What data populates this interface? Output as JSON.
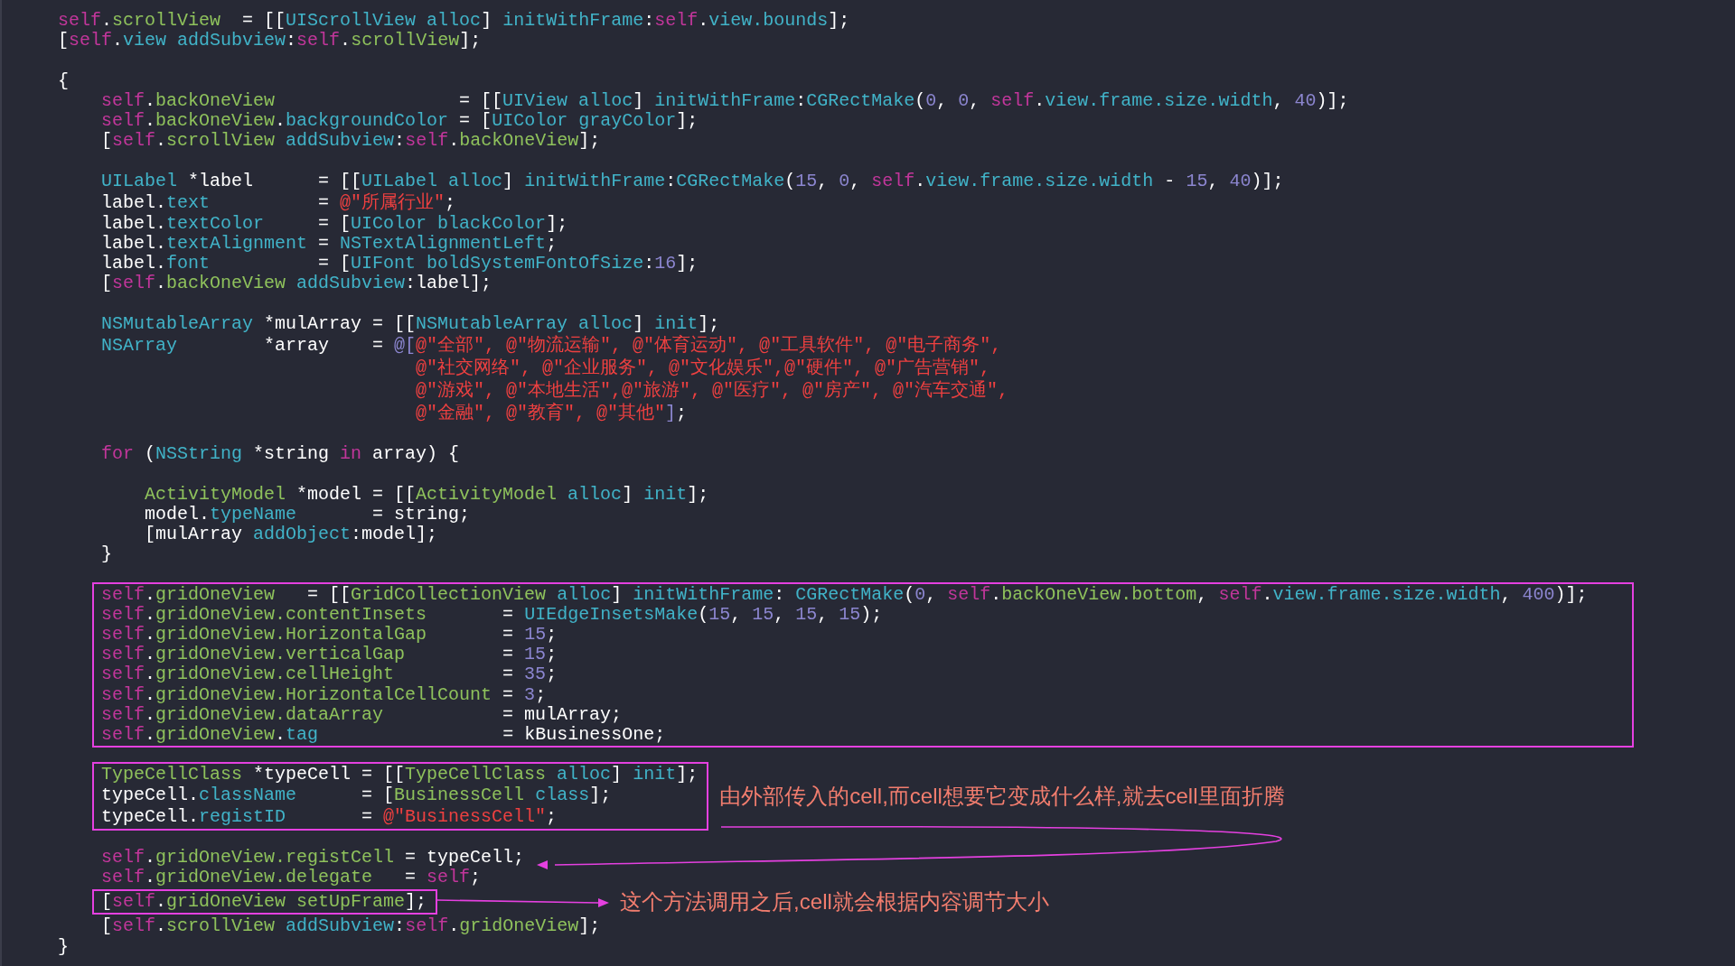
{
  "editor": {
    "sections": [
      {
        "blocks": [
          {
            "boxed": false,
            "lines": [
              [
                {
                  "kind": "kw",
                  "text": "self"
                },
                {
                  "kind": "plain",
                  "text": "."
                },
                {
                  "kind": "proj",
                  "text": "scrollView"
                },
                {
                  "kind": "plain",
                  "text": "  = [["
                },
                {
                  "kind": "sys",
                  "text": "UIScrollView alloc"
                },
                {
                  "kind": "plain",
                  "text": "] "
                },
                {
                  "kind": "sys",
                  "text": "initWithFrame"
                },
                {
                  "kind": "plain",
                  "text": ":"
                },
                {
                  "kind": "kw",
                  "text": "self"
                },
                {
                  "kind": "plain",
                  "text": "."
                },
                {
                  "kind": "sys",
                  "text": "view.bounds"
                },
                {
                  "kind": "plain",
                  "text": "];"
                }
              ],
              [
                {
                  "kind": "plain",
                  "text": "["
                },
                {
                  "kind": "kw",
                  "text": "self"
                },
                {
                  "kind": "plain",
                  "text": "."
                },
                {
                  "kind": "sys",
                  "text": "view addSubview"
                },
                {
                  "kind": "plain",
                  "text": ":"
                },
                {
                  "kind": "kw",
                  "text": "self"
                },
                {
                  "kind": "plain",
                  "text": "."
                },
                {
                  "kind": "proj",
                  "text": "scrollView"
                },
                {
                  "kind": "plain",
                  "text": "];"
                }
              ]
            ]
          }
        ]
      },
      {
        "blocks": [
          {
            "boxed": false,
            "lines": [
              [
                {
                  "kind": "plain",
                  "text": "{"
                }
              ]
            ]
          },
          {
            "boxed": false,
            "lines": [
              [
                {
                  "kind": "kw",
                  "text": "    self"
                },
                {
                  "kind": "plain",
                  "text": "."
                },
                {
                  "kind": "proj",
                  "text": "backOneView"
                },
                {
                  "kind": "plain",
                  "text": "                 = [["
                },
                {
                  "kind": "sys",
                  "text": "UIView alloc"
                },
                {
                  "kind": "plain",
                  "text": "] "
                },
                {
                  "kind": "sys",
                  "text": "initWithFrame"
                },
                {
                  "kind": "plain",
                  "text": ":"
                },
                {
                  "kind": "sys",
                  "text": "CGRectMake"
                },
                {
                  "kind": "plain",
                  "text": "("
                },
                {
                  "kind": "num",
                  "text": "0"
                },
                {
                  "kind": "plain",
                  "text": ", "
                },
                {
                  "kind": "num",
                  "text": "0"
                },
                {
                  "kind": "plain",
                  "text": ", "
                },
                {
                  "kind": "kw",
                  "text": "self"
                },
                {
                  "kind": "plain",
                  "text": "."
                },
                {
                  "kind": "sys",
                  "text": "view.frame.size.width"
                },
                {
                  "kind": "plain",
                  "text": ", "
                },
                {
                  "kind": "num",
                  "text": "40"
                },
                {
                  "kind": "plain",
                  "text": ")];"
                }
              ],
              [
                {
                  "kind": "kw",
                  "text": "    self"
                },
                {
                  "kind": "plain",
                  "text": "."
                },
                {
                  "kind": "proj",
                  "text": "backOneView"
                },
                {
                  "kind": "plain",
                  "text": "."
                },
                {
                  "kind": "sys",
                  "text": "backgroundColor"
                },
                {
                  "kind": "plain",
                  "text": " = ["
                },
                {
                  "kind": "sys",
                  "text": "UIColor grayColor"
                },
                {
                  "kind": "plain",
                  "text": "];"
                }
              ],
              [
                {
                  "kind": "plain",
                  "text": "    ["
                },
                {
                  "kind": "kw",
                  "text": "self"
                },
                {
                  "kind": "plain",
                  "text": "."
                },
                {
                  "kind": "proj",
                  "text": "scrollView"
                },
                {
                  "kind": "sys",
                  "text": " addSubview"
                },
                {
                  "kind": "plain",
                  "text": ":"
                },
                {
                  "kind": "kw",
                  "text": "self"
                },
                {
                  "kind": "plain",
                  "text": "."
                },
                {
                  "kind": "proj",
                  "text": "backOneView"
                },
                {
                  "kind": "plain",
                  "text": "];"
                }
              ]
            ]
          }
        ]
      },
      {
        "blocks": [
          {
            "boxed": false,
            "lines": [
              [
                {
                  "kind": "sys",
                  "text": "    UILabel"
                },
                {
                  "kind": "plain",
                  "text": " *label      = [["
                },
                {
                  "kind": "sys",
                  "text": "UILabel alloc"
                },
                {
                  "kind": "plain",
                  "text": "] "
                },
                {
                  "kind": "sys",
                  "text": "initWithFrame"
                },
                {
                  "kind": "plain",
                  "text": ":"
                },
                {
                  "kind": "sys",
                  "text": "CGRectMake"
                },
                {
                  "kind": "plain",
                  "text": "("
                },
                {
                  "kind": "num",
                  "text": "15"
                },
                {
                  "kind": "plain",
                  "text": ", "
                },
                {
                  "kind": "num",
                  "text": "0"
                },
                {
                  "kind": "plain",
                  "text": ", "
                },
                {
                  "kind": "kw",
                  "text": "self"
                },
                {
                  "kind": "plain",
                  "text": "."
                },
                {
                  "kind": "sys",
                  "text": "view.frame.size.width"
                },
                {
                  "kind": "plain",
                  "text": " - "
                },
                {
                  "kind": "num",
                  "text": "15"
                },
                {
                  "kind": "plain",
                  "text": ", "
                },
                {
                  "kind": "num",
                  "text": "40"
                },
                {
                  "kind": "plain",
                  "text": ")];"
                }
              ],
              [
                {
                  "kind": "plain",
                  "text": "    label."
                },
                {
                  "kind": "sys",
                  "text": "text"
                },
                {
                  "kind": "plain",
                  "text": "          = "
                },
                {
                  "kind": "str",
                  "text": "@\"所属行业\""
                },
                {
                  "kind": "plain",
                  "text": ";"
                }
              ],
              [
                {
                  "kind": "plain",
                  "text": "    label."
                },
                {
                  "kind": "sys",
                  "text": "textColor"
                },
                {
                  "kind": "plain",
                  "text": "     = ["
                },
                {
                  "kind": "sys",
                  "text": "UIColor blackColor"
                },
                {
                  "kind": "plain",
                  "text": "];"
                }
              ],
              [
                {
                  "kind": "plain",
                  "text": "    label."
                },
                {
                  "kind": "sys",
                  "text": "textAlignment"
                },
                {
                  "kind": "plain",
                  "text": " = "
                },
                {
                  "kind": "sys",
                  "text": "NSTextAlignmentLeft"
                },
                {
                  "kind": "plain",
                  "text": ";"
                }
              ],
              [
                {
                  "kind": "plain",
                  "text": "    label."
                },
                {
                  "kind": "sys",
                  "text": "font"
                },
                {
                  "kind": "plain",
                  "text": "          = ["
                },
                {
                  "kind": "sys",
                  "text": "UIFont boldSystemFontOfSize"
                },
                {
                  "kind": "plain",
                  "text": ":"
                },
                {
                  "kind": "num",
                  "text": "16"
                },
                {
                  "kind": "plain",
                  "text": "];"
                }
              ],
              [
                {
                  "kind": "plain",
                  "text": "    ["
                },
                {
                  "kind": "kw",
                  "text": "self"
                },
                {
                  "kind": "plain",
                  "text": "."
                },
                {
                  "kind": "proj",
                  "text": "backOneView"
                },
                {
                  "kind": "sys",
                  "text": " addSubview"
                },
                {
                  "kind": "plain",
                  "text": ":label];"
                }
              ]
            ]
          }
        ]
      },
      {
        "blocks": [
          {
            "boxed": false,
            "lines": [
              [
                {
                  "kind": "sys",
                  "text": "    NSMutableArray"
                },
                {
                  "kind": "plain",
                  "text": " *mulArray = [["
                },
                {
                  "kind": "sys",
                  "text": "NSMutableArray alloc"
                },
                {
                  "kind": "plain",
                  "text": "] "
                },
                {
                  "kind": "sys",
                  "text": "init"
                },
                {
                  "kind": "plain",
                  "text": "];"
                }
              ],
              [
                {
                  "kind": "sys",
                  "text": "    NSArray"
                },
                {
                  "kind": "plain",
                  "text": "        *array    = "
                },
                {
                  "kind": "num",
                  "text": "@["
                },
                {
                  "kind": "str",
                  "text": "@\"全部\", @\"物流运输\", @\"体育运动\", @\"工具软件\", @\"电子商务\","
                }
              ],
              [
                {
                  "kind": "str",
                  "text": "                                 @\"社交网络\", @\"企业服务\", @\"文化娱乐\",@\"硬件\", @\"广告营销\","
                }
              ],
              [
                {
                  "kind": "str",
                  "text": "                                 @\"游戏\", @\"本地生活\",@\"旅游\", @\"医疗\", @\"房产\", @\"汽车交通\","
                }
              ],
              [
                {
                  "kind": "str",
                  "text": "                                 @\"金融\", @\"教育\", @\"其他\""
                },
                {
                  "kind": "num",
                  "text": "]"
                },
                {
                  "kind": "plain",
                  "text": ";"
                }
              ]
            ]
          }
        ]
      },
      {
        "blocks": [
          {
            "boxed": false,
            "lines": [
              [
                {
                  "kind": "kw",
                  "text": "    for"
                },
                {
                  "kind": "plain",
                  "text": " ("
                },
                {
                  "kind": "sys",
                  "text": "NSString"
                },
                {
                  "kind": "plain",
                  "text": " *string "
                },
                {
                  "kind": "kw",
                  "text": "in"
                },
                {
                  "kind": "plain",
                  "text": " array) {"
                }
              ]
            ]
          }
        ]
      },
      {
        "blocks": [
          {
            "boxed": false,
            "lines": [
              [
                {
                  "kind": "proj",
                  "text": "        ActivityModel"
                },
                {
                  "kind": "plain",
                  "text": " *model = [["
                },
                {
                  "kind": "proj",
                  "text": "ActivityModel"
                },
                {
                  "kind": "sys",
                  "text": " alloc"
                },
                {
                  "kind": "plain",
                  "text": "] "
                },
                {
                  "kind": "sys",
                  "text": "init"
                },
                {
                  "kind": "plain",
                  "text": "];"
                }
              ],
              [
                {
                  "kind": "plain",
                  "text": "        model."
                },
                {
                  "kind": "sys",
                  "text": "typeName"
                },
                {
                  "kind": "plain",
                  "text": "       = string;"
                }
              ],
              [
                {
                  "kind": "plain",
                  "text": "        [mulArray "
                },
                {
                  "kind": "sys",
                  "text": "addObject"
                },
                {
                  "kind": "plain",
                  "text": ":model];"
                }
              ],
              [
                {
                  "kind": "plain",
                  "text": "    }"
                }
              ]
            ]
          }
        ]
      },
      {
        "blocks": [
          {
            "boxed": true,
            "lines": [
              [
                {
                  "kind": "kw",
                  "text": "self"
                },
                {
                  "kind": "plain",
                  "text": "."
                },
                {
                  "kind": "proj",
                  "text": "gridOneView"
                },
                {
                  "kind": "plain",
                  "text": "   = [["
                },
                {
                  "kind": "proj",
                  "text": "GridCollectionView"
                },
                {
                  "kind": "sys",
                  "text": " alloc"
                },
                {
                  "kind": "plain",
                  "text": "] "
                },
                {
                  "kind": "sys",
                  "text": "initWithFrame"
                },
                {
                  "kind": "plain",
                  "text": ": "
                },
                {
                  "kind": "sys",
                  "text": "CGRectMake"
                },
                {
                  "kind": "plain",
                  "text": "("
                },
                {
                  "kind": "num",
                  "text": "0"
                },
                {
                  "kind": "plain",
                  "text": ", "
                },
                {
                  "kind": "kw",
                  "text": "self"
                },
                {
                  "kind": "plain",
                  "text": "."
                },
                {
                  "kind": "proj",
                  "text": "backOneView.bottom"
                },
                {
                  "kind": "plain",
                  "text": ", "
                },
                {
                  "kind": "kw",
                  "text": "self"
                },
                {
                  "kind": "plain",
                  "text": "."
                },
                {
                  "kind": "sys",
                  "text": "view.frame.size.width"
                },
                {
                  "kind": "plain",
                  "text": ", "
                },
                {
                  "kind": "num",
                  "text": "400"
                },
                {
                  "kind": "plain",
                  "text": ")];"
                }
              ],
              [
                {
                  "kind": "kw",
                  "text": "self"
                },
                {
                  "kind": "plain",
                  "text": "."
                },
                {
                  "kind": "proj",
                  "text": "gridOneView.contentInsets"
                },
                {
                  "kind": "plain",
                  "text": "       = "
                },
                {
                  "kind": "sys",
                  "text": "UIEdgeInsetsMake"
                },
                {
                  "kind": "plain",
                  "text": "("
                },
                {
                  "kind": "num",
                  "text": "15"
                },
                {
                  "kind": "plain",
                  "text": ", "
                },
                {
                  "kind": "num",
                  "text": "15"
                },
                {
                  "kind": "plain",
                  "text": ", "
                },
                {
                  "kind": "num",
                  "text": "15"
                },
                {
                  "kind": "plain",
                  "text": ", "
                },
                {
                  "kind": "num",
                  "text": "15"
                },
                {
                  "kind": "plain",
                  "text": ");"
                }
              ],
              [
                {
                  "kind": "kw",
                  "text": "self"
                },
                {
                  "kind": "plain",
                  "text": "."
                },
                {
                  "kind": "proj",
                  "text": "gridOneView.HorizontalGap"
                },
                {
                  "kind": "plain",
                  "text": "       = "
                },
                {
                  "kind": "num",
                  "text": "15"
                },
                {
                  "kind": "plain",
                  "text": ";"
                }
              ],
              [
                {
                  "kind": "kw",
                  "text": "self"
                },
                {
                  "kind": "plain",
                  "text": "."
                },
                {
                  "kind": "proj",
                  "text": "gridOneView.verticalGap"
                },
                {
                  "kind": "plain",
                  "text": "         = "
                },
                {
                  "kind": "num",
                  "text": "15"
                },
                {
                  "kind": "plain",
                  "text": ";"
                }
              ],
              [
                {
                  "kind": "kw",
                  "text": "self"
                },
                {
                  "kind": "plain",
                  "text": "."
                },
                {
                  "kind": "proj",
                  "text": "gridOneView.cellHeight"
                },
                {
                  "kind": "plain",
                  "text": "          = "
                },
                {
                  "kind": "num",
                  "text": "35"
                },
                {
                  "kind": "plain",
                  "text": ";"
                }
              ],
              [
                {
                  "kind": "kw",
                  "text": "self"
                },
                {
                  "kind": "plain",
                  "text": "."
                },
                {
                  "kind": "proj",
                  "text": "gridOneView.HorizontalCellCount"
                },
                {
                  "kind": "plain",
                  "text": " = "
                },
                {
                  "kind": "num",
                  "text": "3"
                },
                {
                  "kind": "plain",
                  "text": ";"
                }
              ],
              [
                {
                  "kind": "kw",
                  "text": "self"
                },
                {
                  "kind": "plain",
                  "text": "."
                },
                {
                  "kind": "proj",
                  "text": "gridOneView.dataArray"
                },
                {
                  "kind": "plain",
                  "text": "           = mulArray;"
                }
              ],
              [
                {
                  "kind": "kw",
                  "text": "self"
                },
                {
                  "kind": "plain",
                  "text": "."
                },
                {
                  "kind": "proj",
                  "text": "gridOneView"
                },
                {
                  "kind": "plain",
                  "text": "."
                },
                {
                  "kind": "sys",
                  "text": "tag"
                },
                {
                  "kind": "plain",
                  "text": "                 = kBusinessOne;"
                }
              ]
            ]
          }
        ]
      },
      {
        "blocks": [
          {
            "boxed": true,
            "note": "由外部传入的cell,而cell想要它变成什么样,就去cell里面折腾",
            "lines": [
              [
                {
                  "kind": "proj",
                  "text": "TypeCellClass"
                },
                {
                  "kind": "plain",
                  "text": " *typeCell = [["
                },
                {
                  "kind": "proj",
                  "text": "TypeCellClass"
                },
                {
                  "kind": "sys",
                  "text": " alloc"
                },
                {
                  "kind": "plain",
                  "text": "] "
                },
                {
                  "kind": "sys",
                  "text": "init"
                },
                {
                  "kind": "plain",
                  "text": "];"
                }
              ],
              [
                {
                  "kind": "plain",
                  "text": "typeCell."
                },
                {
                  "kind": "sys",
                  "text": "className"
                },
                {
                  "kind": "plain",
                  "text": "      = ["
                },
                {
                  "kind": "proj",
                  "text": "BusinessCell"
                },
                {
                  "kind": "sys",
                  "text": " class"
                },
                {
                  "kind": "plain",
                  "text": "];"
                }
              ],
              [
                {
                  "kind": "plain",
                  "text": "typeCell."
                },
                {
                  "kind": "sys",
                  "text": "registID"
                },
                {
                  "kind": "plain",
                  "text": "       = "
                },
                {
                  "kind": "str",
                  "text": "@\"BusinessCell\""
                },
                {
                  "kind": "plain",
                  "text": ";"
                }
              ]
            ]
          }
        ]
      },
      {
        "blocks": [
          {
            "boxed": false,
            "lines": [
              [
                {
                  "kind": "kw",
                  "text": "    self"
                },
                {
                  "kind": "plain",
                  "text": "."
                },
                {
                  "kind": "proj",
                  "text": "gridOneView.registCell"
                },
                {
                  "kind": "plain",
                  "text": " = typeCell;"
                }
              ],
              [
                {
                  "kind": "kw",
                  "text": "    self"
                },
                {
                  "kind": "plain",
                  "text": "."
                },
                {
                  "kind": "proj",
                  "text": "gridOneView.delegate"
                },
                {
                  "kind": "plain",
                  "text": "   = "
                },
                {
                  "kind": "kw",
                  "text": "self"
                },
                {
                  "kind": "plain",
                  "text": ";"
                }
              ]
            ]
          },
          {
            "boxed": true,
            "note": "这个方法调用之后,cell就会根据内容调节大小",
            "lines": [
              [
                {
                  "kind": "plain",
                  "text": "["
                },
                {
                  "kind": "kw",
                  "text": "self"
                },
                {
                  "kind": "plain",
                  "text": "."
                },
                {
                  "kind": "proj",
                  "text": "gridOneView setUpFrame"
                },
                {
                  "kind": "plain",
                  "text": "];"
                }
              ]
            ]
          },
          {
            "boxed": false,
            "lines": [
              [
                {
                  "kind": "plain",
                  "text": "    ["
                },
                {
                  "kind": "kw",
                  "text": "self"
                },
                {
                  "kind": "plain",
                  "text": "."
                },
                {
                  "kind": "proj",
                  "text": "scrollView"
                },
                {
                  "kind": "sys",
                  "text": " addSubview"
                },
                {
                  "kind": "plain",
                  "text": ":"
                },
                {
                  "kind": "kw",
                  "text": "self"
                },
                {
                  "kind": "plain",
                  "text": "."
                },
                {
                  "kind": "proj",
                  "text": "gridOneView"
                },
                {
                  "kind": "plain",
                  "text": "];"
                }
              ],
              [
                {
                  "kind": "plain",
                  "text": "}"
                }
              ]
            ]
          }
        ]
      }
    ]
  }
}
